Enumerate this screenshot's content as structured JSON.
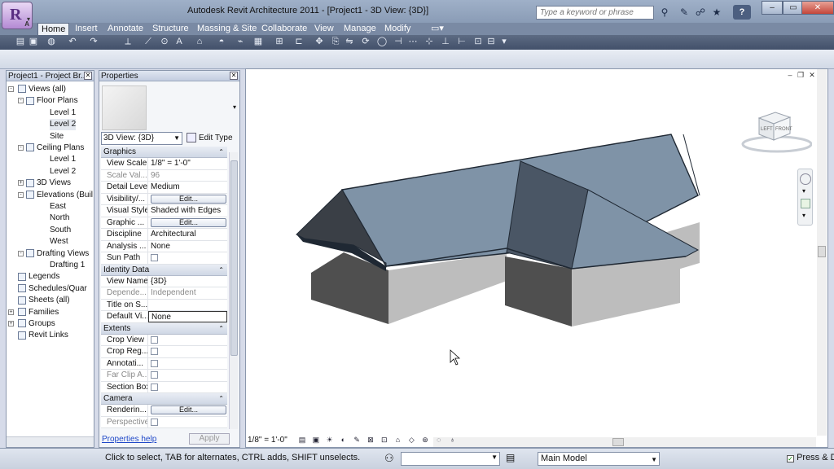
{
  "window": {
    "title": "Autodesk Revit Architecture 2011 - [Project1 - 3D View: {3D}]",
    "search_placeholder": "Type a keyword or phrase",
    "app_letter": "R",
    "app_sub": "A"
  },
  "ribbon": {
    "tabs": [
      "Home",
      "Insert",
      "Annotate",
      "Structure",
      "Massing & Site",
      "Collaborate",
      "View",
      "Manage",
      "Modify"
    ],
    "active_tab": "Home"
  },
  "project_browser": {
    "title": "Project1 - Project Br...",
    "items": [
      {
        "label": "Views (all)",
        "level": 0,
        "expander": "-"
      },
      {
        "label": "Floor Plans",
        "level": 1,
        "expander": "-"
      },
      {
        "label": "Level 1",
        "level": 2
      },
      {
        "label": "Level 2",
        "level": 2,
        "selected": true
      },
      {
        "label": "Site",
        "level": 2
      },
      {
        "label": "Ceiling Plans",
        "level": 1,
        "expander": "-"
      },
      {
        "label": "Level 1",
        "level": 2
      },
      {
        "label": "Level 2",
        "level": 2
      },
      {
        "label": "3D Views",
        "level": 1,
        "expander": "+"
      },
      {
        "label": "Elevations (Buil",
        "level": 1,
        "expander": "-"
      },
      {
        "label": "East",
        "level": 2
      },
      {
        "label": "North",
        "level": 2
      },
      {
        "label": "South",
        "level": 2
      },
      {
        "label": "West",
        "level": 2
      },
      {
        "label": "Drafting Views",
        "level": 1,
        "expander": "-"
      },
      {
        "label": "Drafting 1",
        "level": 2
      },
      {
        "label": "Legends",
        "level": 0
      },
      {
        "label": "Schedules/Quar",
        "level": 0
      },
      {
        "label": "Sheets (all)",
        "level": 0
      },
      {
        "label": "Families",
        "level": 0,
        "expander": "+"
      },
      {
        "label": "Groups",
        "level": 0,
        "expander": "+"
      },
      {
        "label": "Revit Links",
        "level": 0
      }
    ]
  },
  "properties": {
    "title": "Properties",
    "type_selector": "3D View: {3D}",
    "edit_type": "Edit Type",
    "groups": [
      {
        "name": "Graphics",
        "rows": [
          {
            "label": "View Scale",
            "value": "1/8\" = 1'-0\""
          },
          {
            "label": "Scale Val...",
            "value": "96",
            "disabled": true
          },
          {
            "label": "Detail Level",
            "value": "Medium"
          },
          {
            "label": "Visibility/...",
            "button": "Edit..."
          },
          {
            "label": "Visual Style",
            "value": "Shaded with Edges"
          },
          {
            "label": "Graphic ...",
            "button": "Edit..."
          },
          {
            "label": "Discipline",
            "value": "Architectural"
          },
          {
            "label": "Analysis ...",
            "value": "None"
          },
          {
            "label": "Sun Path",
            "checkbox": true
          }
        ]
      },
      {
        "name": "Identity Data",
        "rows": [
          {
            "label": "View Name",
            "value": "{3D}"
          },
          {
            "label": "Depende...",
            "value": "Independent",
            "disabled": true
          },
          {
            "label": "Title on S...",
            "value": ""
          },
          {
            "label": "Default Vi...",
            "value": "None"
          }
        ]
      },
      {
        "name": "Extents",
        "rows": [
          {
            "label": "Crop View",
            "checkbox": true
          },
          {
            "label": "Crop Reg...",
            "checkbox": true
          },
          {
            "label": "Annotati...",
            "checkbox": true
          },
          {
            "label": "Far Clip A...",
            "checkbox": true,
            "disabled": true
          },
          {
            "label": "Section Box",
            "checkbox": true
          }
        ]
      },
      {
        "name": "Camera",
        "rows": [
          {
            "label": "Renderin...",
            "button": "Edit..."
          },
          {
            "label": "Perspective",
            "checkbox": true,
            "disabled": true
          }
        ]
      }
    ],
    "help_link": "Properties help",
    "apply": "Apply"
  },
  "viewport": {
    "scale_label": "1/8\" = 1'-0\"",
    "viewcube_left": "LEFT",
    "viewcube_front": "FRONT"
  },
  "status": {
    "text": "Click to select, TAB for alternates, CTRL adds, SHIFT unselects.",
    "model": "Main Model",
    "press_drag": "Press & D"
  },
  "colors": {
    "roof": "#7f93a7",
    "wall_shadow": "#4f4f4f",
    "wall_lit": "#bdbdbd"
  }
}
